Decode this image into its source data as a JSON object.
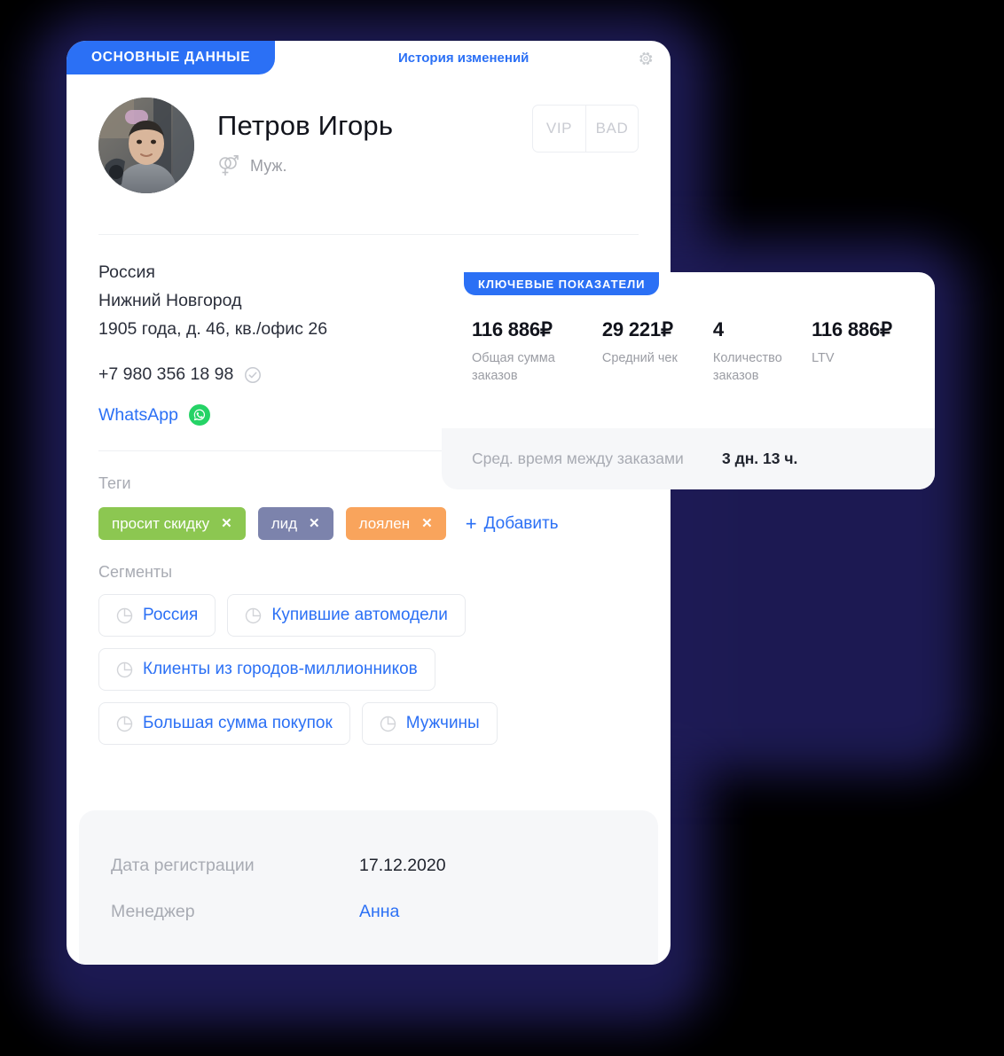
{
  "tabs": {
    "active_label": "ОСНОВНЫЕ ДАННЫЕ",
    "inactive_label": "История изменений",
    "settings_icon": "gear-icon"
  },
  "profile": {
    "name": "Петров Игорь",
    "gender_icon": "male-female-icon",
    "gender_label": "Муж.",
    "avatar_icon": "user-photo",
    "flags": [
      "VIP",
      "BAD"
    ]
  },
  "contacts": {
    "country": "Россия",
    "city": "Нижний Новгород",
    "street": "1905 года, д. 46, кв./офис 26",
    "phone": "+7 980 356 18 98",
    "phone_verified_icon": "check-circle-icon",
    "messenger_label": "WhatsApp",
    "messenger_icon": "whatsapp-icon"
  },
  "tags": {
    "title": "Теги",
    "items": [
      {
        "label": "просит скидку",
        "color": "#8CC751",
        "remove_icon": "close-icon"
      },
      {
        "label": "лид",
        "color": "#7C83AC",
        "remove_icon": "close-icon"
      },
      {
        "label": "лоялен",
        "color": "#F9A45C",
        "remove_icon": "close-icon"
      }
    ],
    "add_plus": "+",
    "add_label": "Добавить"
  },
  "segments": {
    "title": "Сегменты",
    "icon": "pie-chart-icon",
    "rows": [
      [
        "Россия",
        "Купившие автомодели"
      ],
      [
        "Клиенты из городов-миллионников"
      ],
      [
        "Большая сумма покупок",
        "Мужчины"
      ]
    ]
  },
  "footer": {
    "rows": [
      {
        "key": "Дата регистрации",
        "value": "17.12.2020",
        "is_link": false
      },
      {
        "key": "Менеджер",
        "value": "Анна",
        "is_link": true
      }
    ]
  },
  "kpi": {
    "badge": "КЛЮЧЕВЫЕ ПОКАЗАТЕЛИ",
    "metrics": [
      {
        "value": "116 886₽",
        "label": "Общая сумма заказов"
      },
      {
        "value": "29 221₽",
        "label": "Средний чек"
      },
      {
        "value": "4",
        "label": "Количество заказов"
      },
      {
        "value": "116 886₽",
        "label": "LTV"
      }
    ],
    "footer_key": "Сред. время между заказами",
    "footer_value": "3 дн. 13 ч."
  },
  "colors": {
    "accent": "#2B70F5",
    "text": "#20242E",
    "muted": "#A8ABB3",
    "surface": "#FFFFFF",
    "backdrop": "#000000",
    "glow": "#1E1B56"
  }
}
